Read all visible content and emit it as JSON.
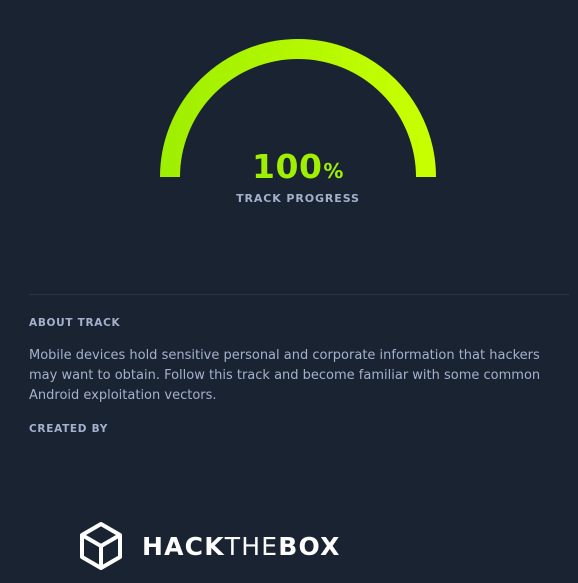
{
  "track_progress": {
    "value": "100",
    "unit": "%",
    "fraction": 1.0,
    "label": "TRACK PROGRESS",
    "gradient_start": "#9fef00",
    "gradient_end": "#c8ff00"
  },
  "about": {
    "heading": "ABOUT TRACK",
    "text": "Mobile devices hold sensitive personal and corporate information that hackers may want to obtain. Follow this track and become familiar with some common Android exploitation vectors."
  },
  "created_by": {
    "heading": "CREATED BY",
    "logo": {
      "icon": "hackthebox-cube-icon",
      "text_part1": "HACK",
      "text_part2": "THE",
      "text_part3": "BOX"
    }
  },
  "colors": {
    "background": "#1a2332",
    "accent": "#9fef00",
    "text_muted": "#a4b1cd"
  }
}
